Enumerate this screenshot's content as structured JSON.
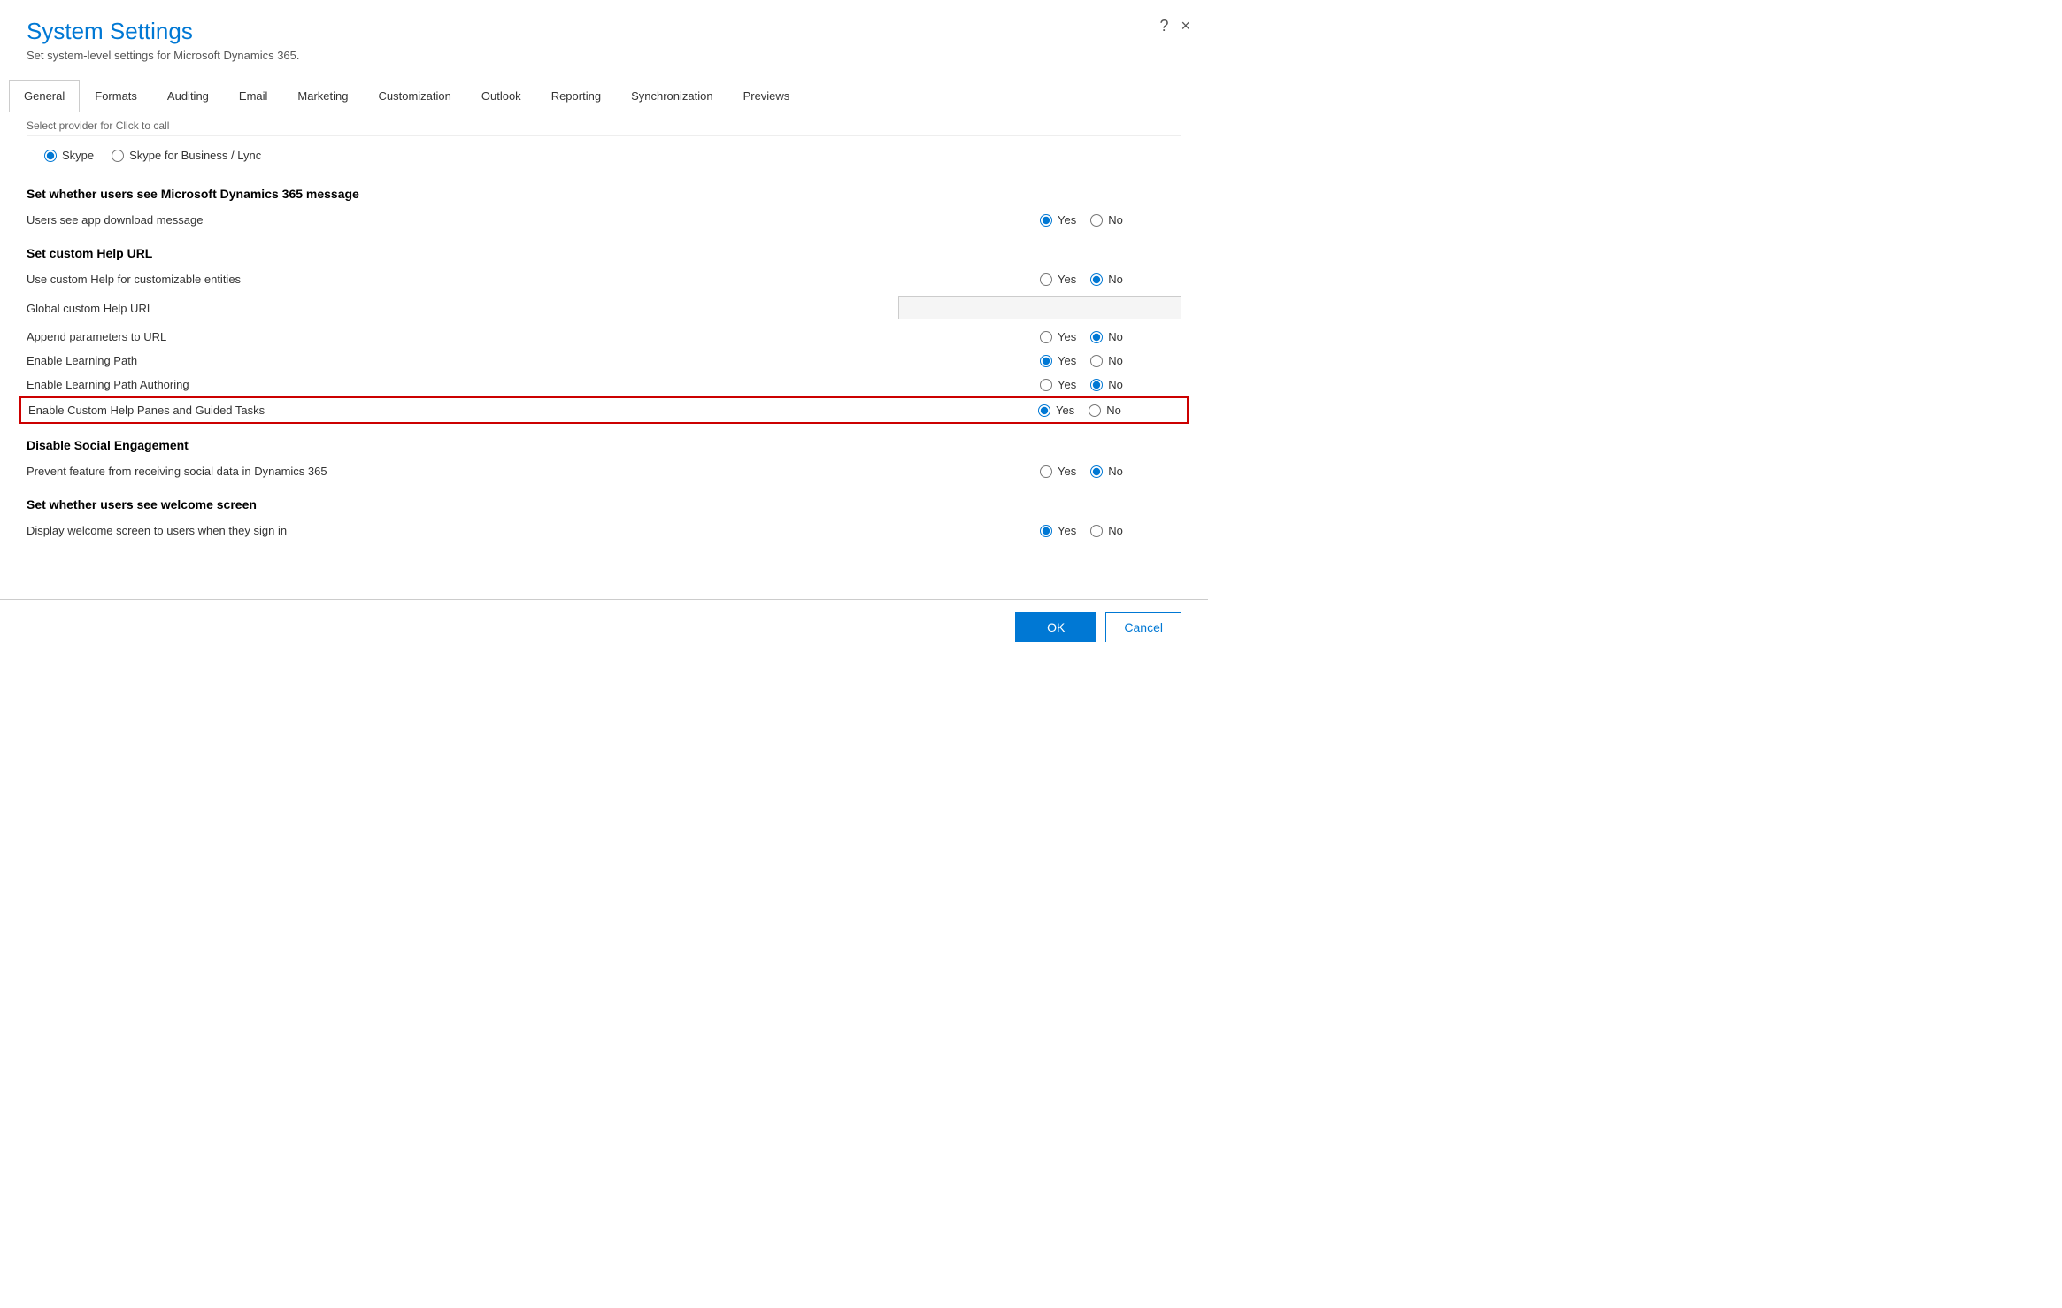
{
  "dialog": {
    "title": "System Settings",
    "subtitle": "Set system-level settings for Microsoft Dynamics 365.",
    "help_btn": "?",
    "close_btn": "×"
  },
  "tabs": [
    {
      "id": "general",
      "label": "General",
      "active": true
    },
    {
      "id": "formats",
      "label": "Formats",
      "active": false
    },
    {
      "id": "auditing",
      "label": "Auditing",
      "active": false
    },
    {
      "id": "email",
      "label": "Email",
      "active": false
    },
    {
      "id": "marketing",
      "label": "Marketing",
      "active": false
    },
    {
      "id": "customization",
      "label": "Customization",
      "active": false
    },
    {
      "id": "outlook",
      "label": "Outlook",
      "active": false
    },
    {
      "id": "reporting",
      "label": "Reporting",
      "active": false
    },
    {
      "id": "synchronization",
      "label": "Synchronization",
      "active": false
    },
    {
      "id": "previews",
      "label": "Previews",
      "active": false
    }
  ],
  "scroll_hint": "Select provider for Click to call",
  "click_to_call": {
    "label1": "Skype",
    "label2": "Skype for Business / Lync",
    "selected": "skype"
  },
  "sections": [
    {
      "id": "ms_message",
      "title": "Set whether users see Microsoft Dynamics 365 message",
      "rows": [
        {
          "id": "app_download",
          "label": "Users see app download message",
          "yes_checked": true,
          "no_checked": false,
          "has_input": false
        }
      ]
    },
    {
      "id": "custom_help",
      "title": "Set custom Help URL",
      "rows": [
        {
          "id": "use_custom_help",
          "label": "Use custom Help for customizable entities",
          "yes_checked": false,
          "no_checked": true,
          "has_input": false
        },
        {
          "id": "global_help_url",
          "label": "Global custom Help URL",
          "has_input": true,
          "input_value": "",
          "yes_checked": false,
          "no_checked": false,
          "show_radios": false
        },
        {
          "id": "append_params",
          "label": "Append parameters to URL",
          "yes_checked": false,
          "no_checked": true,
          "has_input": false
        },
        {
          "id": "learning_path",
          "label": "Enable Learning Path",
          "yes_checked": true,
          "no_checked": false,
          "has_input": false
        },
        {
          "id": "learning_path_authoring",
          "label": "Enable Learning Path Authoring",
          "yes_checked": false,
          "no_checked": true,
          "has_input": false
        },
        {
          "id": "custom_help_panes",
          "label": "Enable Custom Help Panes and Guided Tasks",
          "yes_checked": true,
          "no_checked": false,
          "has_input": false,
          "highlighted": true
        }
      ]
    },
    {
      "id": "social_engagement",
      "title": "Disable Social Engagement",
      "rows": [
        {
          "id": "prevent_social",
          "label": "Prevent feature from receiving social data in Dynamics 365",
          "yes_checked": false,
          "no_checked": true,
          "has_input": false
        }
      ]
    },
    {
      "id": "welcome_screen",
      "title": "Set whether users see welcome screen",
      "rows": [
        {
          "id": "display_welcome",
          "label": "Display welcome screen to users when they sign in",
          "yes_checked": true,
          "no_checked": false,
          "has_input": false
        }
      ]
    }
  ],
  "footer": {
    "ok_label": "OK",
    "cancel_label": "Cancel"
  }
}
